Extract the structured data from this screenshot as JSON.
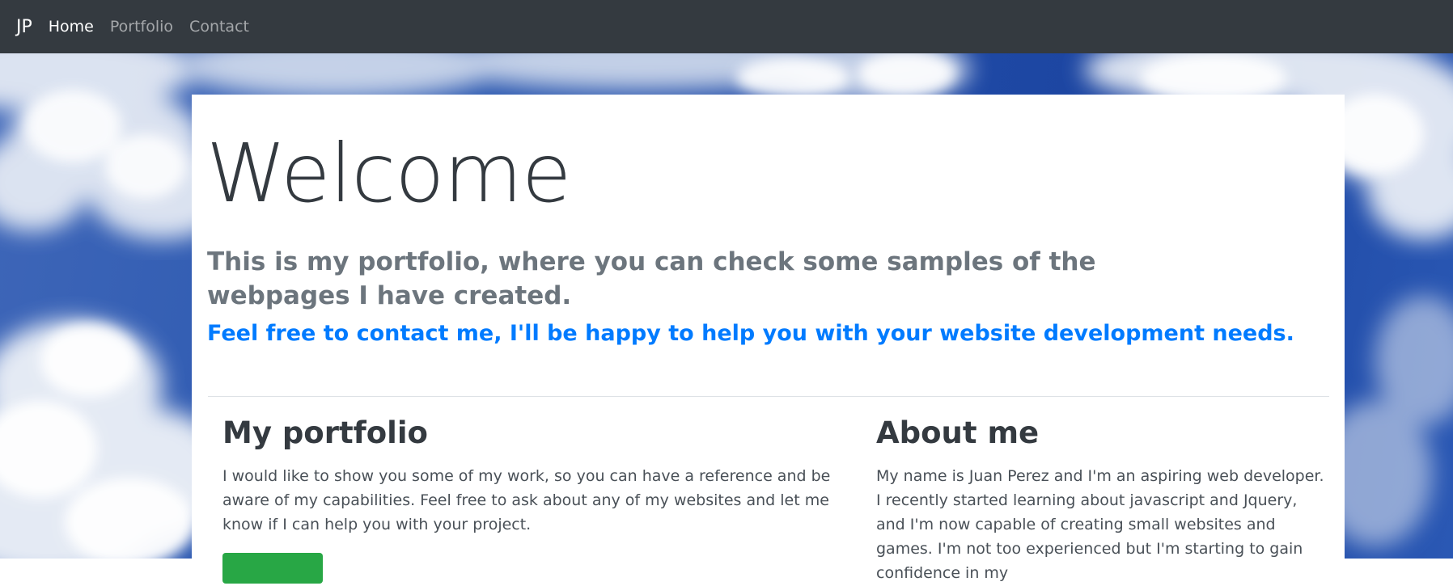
{
  "navbar": {
    "brand": "JP",
    "links": [
      {
        "label": "Home",
        "active": true
      },
      {
        "label": "Portfolio",
        "active": false
      },
      {
        "label": "Contact",
        "active": false
      }
    ]
  },
  "hero": {
    "title": "Welcome",
    "lead": "This is my portfolio, where you can check some samples of the webpages I have created.",
    "cta_text": "Feel free to contact me, I'll be happy to help you with your website development needs."
  },
  "sections": {
    "portfolio": {
      "heading": "My portfolio",
      "text": "I would like to show you some of my work, so you can have a reference and be aware of my capabilities. Feel free to ask about any of my websites and let me know if I can help you with your project.",
      "button_label": ""
    },
    "about": {
      "heading": "About me",
      "text": "My name is Juan Perez and I'm an aspiring web developer. I recently started learning about javascript and Jquery, and I'm now capable of creating small websites and games. I'm not too experienced but I'm starting to gain confidence in my"
    }
  },
  "colors": {
    "navbar_bg": "#343a40",
    "accent_blue": "#007bff",
    "button_green": "#28a745",
    "sky_blue": "#2554ad"
  }
}
